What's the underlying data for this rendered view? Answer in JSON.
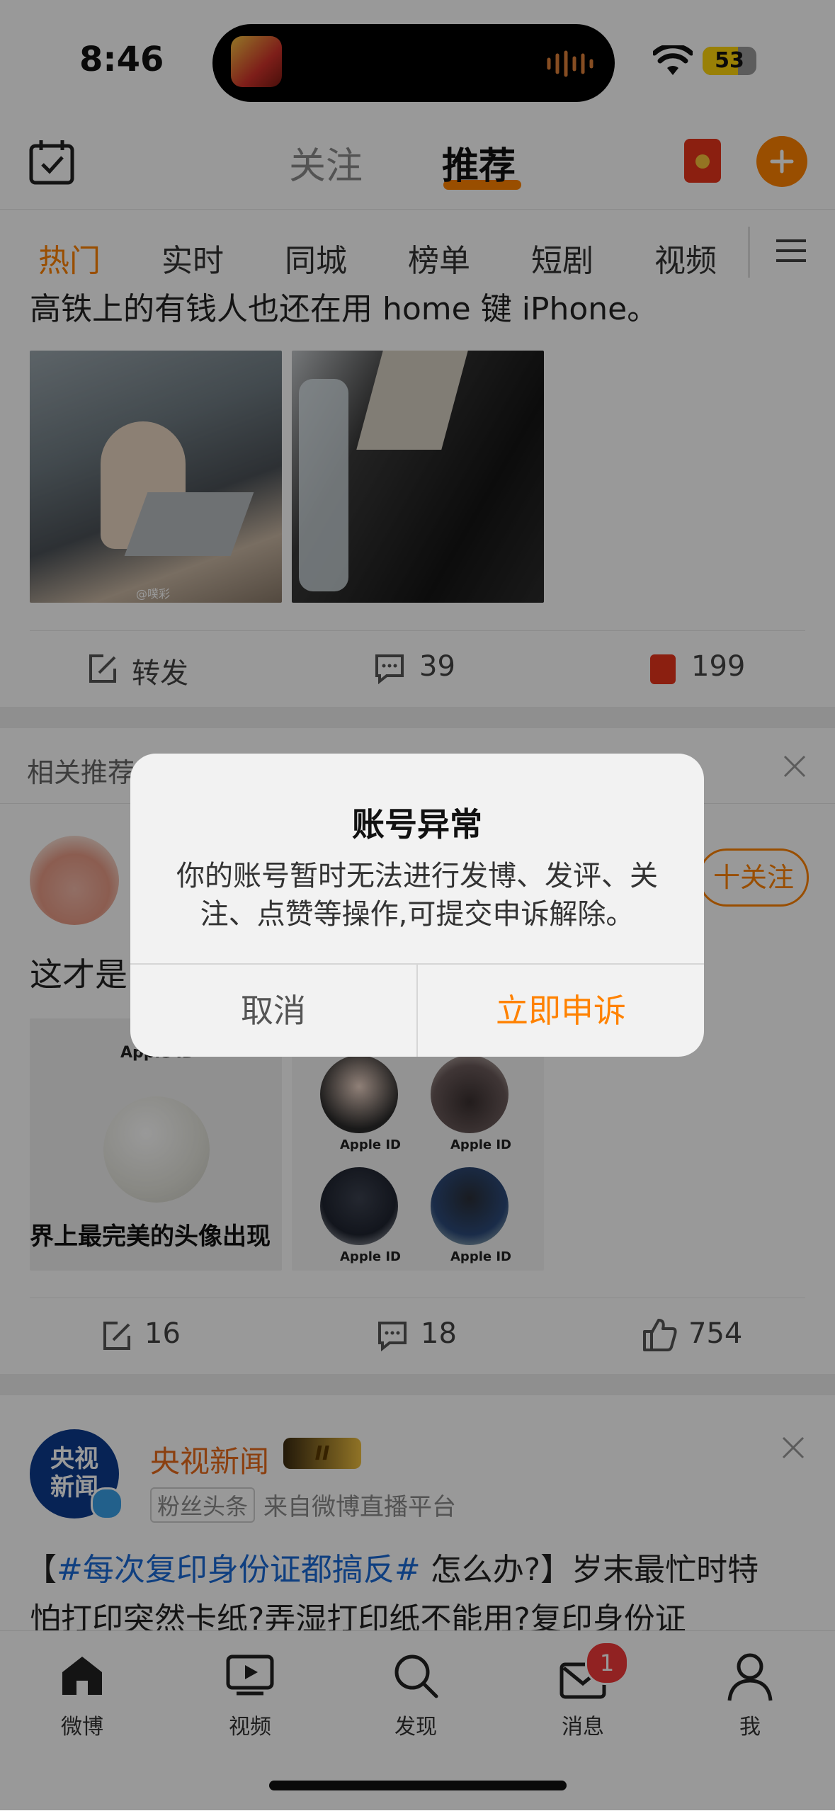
{
  "status_bar": {
    "time": "8:46",
    "battery": "53"
  },
  "top_nav": {
    "tabs": [
      "关注",
      "推荐"
    ],
    "active_tab": "推荐"
  },
  "channels": [
    "热门",
    "实时",
    "同城",
    "榜单",
    "短剧",
    "视频"
  ],
  "active_channel": "热门",
  "post1": {
    "text": "高铁上的有钱人也还在用 home 键 iPhone。",
    "watermark": "@噗彩",
    "repost_label": "转发",
    "comments": "39",
    "likes": "199"
  },
  "related": {
    "title": "相关推荐",
    "follow_label": "十关注",
    "post_text": "这才是",
    "img1_top": "Apple ID",
    "img1_caption": "界上最完美的头像出现",
    "img2_labels": [
      "Apple ID",
      "Apple ID",
      "Apple ID",
      "Apple ID"
    ],
    "reposts": "16",
    "comments": "18",
    "likes": "754"
  },
  "post3": {
    "avatar_text": "央视新闻",
    "author": "央视新闻",
    "vip_level": "II",
    "fan_tag": "粉丝头条",
    "source": "来自微博直播平台",
    "hashtag": "#每次复印身份证都搞反#",
    "line1_rest": " 怎么办?】岁末最忙时特",
    "line1_prefix": "【",
    "line2": "怕打印突然卡纸?弄湿打印纸不能用?复印身份证"
  },
  "tab_bar": {
    "items": [
      "微博",
      "视频",
      "发现",
      "消息",
      "我"
    ],
    "message_badge": "1"
  },
  "alert": {
    "title": "账号异常",
    "message": "你的账号暂时无法进行发博、发评、关注、点赞等操作,可提交申诉解除。",
    "cancel_label": "取消",
    "appeal_label": "立即申诉"
  },
  "colors": {
    "accent": "#ff8200",
    "link": "#1a6ad6",
    "badge": "#f23a3a"
  }
}
